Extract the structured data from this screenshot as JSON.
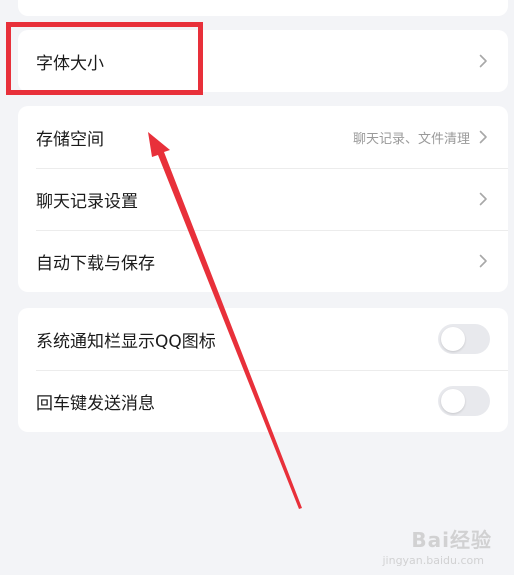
{
  "group_font": {
    "font_size_label": "字体大小"
  },
  "group_storage": {
    "storage_label": "存储空间",
    "storage_value": "聊天记录、文件清理",
    "chat_history_label": "聊天记录设置",
    "auto_download_label": "自动下载与保存"
  },
  "group_toggles": {
    "notif_bar_label": "系统通知栏显示QQ图标",
    "notif_bar_on": false,
    "enter_send_label": "回车键发送消息",
    "enter_send_on": false
  },
  "annotation": {
    "highlight_color": "#e8303a",
    "arrow_color": "#e8303a"
  },
  "watermark": {
    "brand": "Bai经验",
    "url": "jingyan.baidu.com"
  }
}
